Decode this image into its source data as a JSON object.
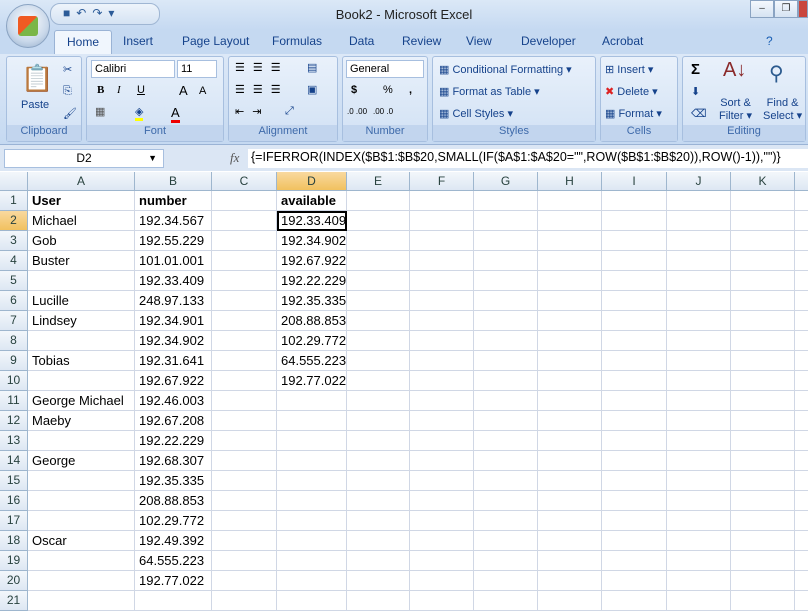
{
  "window": {
    "title": "Book2 - Microsoft Excel"
  },
  "tabs": [
    "Home",
    "Insert",
    "Page Layout",
    "Formulas",
    "Data",
    "Review",
    "View",
    "Developer",
    "Acrobat"
  ],
  "ribbon": {
    "clipboard": {
      "label": "Clipboard",
      "paste": "Paste"
    },
    "font": {
      "label": "Font",
      "name": "Calibri",
      "size": "11",
      "bold": "B",
      "italic": "I",
      "underline": "U",
      "grow": "A",
      "shrink": "A",
      "color": "A"
    },
    "alignment": {
      "label": "Alignment"
    },
    "number": {
      "label": "Number",
      "format": "General",
      "currency": "$",
      "percent": "%",
      "comma": ",",
      "inc": ".0 .00",
      "dec": ".00 .0"
    },
    "styles": {
      "label": "Styles",
      "conditional": "Conditional Formatting",
      "format_table": "Format as Table",
      "cell_styles": "Cell Styles"
    },
    "cells": {
      "label": "Cells",
      "insert": "Insert",
      "delete": "Delete",
      "format": "Format"
    },
    "editing": {
      "label": "Editing",
      "sum": "Σ",
      "sort1": "Sort &",
      "sort2": "Filter",
      "find1": "Find &",
      "find2": "Select"
    }
  },
  "formula_bar": {
    "name_box": "D2",
    "fx": "fx",
    "formula": "{=IFERROR(INDEX($B$1:$B$20,SMALL(IF($A$1:$A$20=\"\",ROW($B$1:$B$20)),ROW()-1)),\"\")}"
  },
  "columns": [
    "A",
    "B",
    "C",
    "D",
    "E",
    "F",
    "G",
    "H",
    "I",
    "J",
    "K"
  ],
  "active_cell": "D2",
  "rows": [
    {
      "A": "User",
      "B": "number",
      "D": "available"
    },
    {
      "A": "Michael",
      "B": "192.34.567",
      "D": "192.33.409"
    },
    {
      "A": "Gob",
      "B": "192.55.229",
      "D": "192.34.902"
    },
    {
      "A": "Buster",
      "B": "101.01.001",
      "D": "192.67.922"
    },
    {
      "A": "",
      "B": "192.33.409",
      "D": "192.22.229"
    },
    {
      "A": "Lucille",
      "B": "248.97.133",
      "D": "192.35.335"
    },
    {
      "A": "Lindsey",
      "B": "192.34.901",
      "D": "208.88.853"
    },
    {
      "A": "",
      "B": "192.34.902",
      "D": "102.29.772"
    },
    {
      "A": "Tobias",
      "B": "192.31.641",
      "D": "64.555.223"
    },
    {
      "A": "",
      "B": "192.67.922",
      "D": "192.77.022"
    },
    {
      "A": "George Michael",
      "B": "192.46.003"
    },
    {
      "A": "Maeby",
      "B": "192.67.208"
    },
    {
      "A": "",
      "B": "192.22.229"
    },
    {
      "A": "George",
      "B": "192.68.307"
    },
    {
      "A": "",
      "B": "192.35.335"
    },
    {
      "A": "",
      "B": "208.88.853"
    },
    {
      "A": "",
      "B": "102.29.772"
    },
    {
      "A": "Oscar",
      "B": "192.49.392"
    },
    {
      "A": "",
      "B": "64.555.223"
    },
    {
      "A": "",
      "B": "192.77.022"
    },
    {}
  ]
}
